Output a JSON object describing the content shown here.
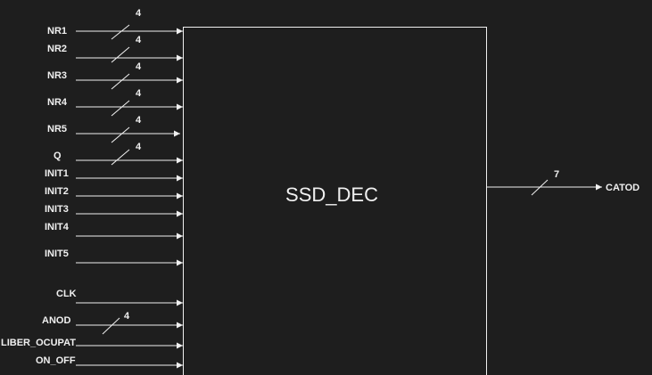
{
  "block": {
    "name": "SSD_DEC"
  },
  "inputs": [
    {
      "label": "NR1",
      "width": "4"
    },
    {
      "label": "NR2",
      "width": "4"
    },
    {
      "label": "NR3",
      "width": "4"
    },
    {
      "label": "NR4",
      "width": "4"
    },
    {
      "label": "NR5",
      "width": "4"
    },
    {
      "label": "Q",
      "width": "4"
    },
    {
      "label": "INIT1",
      "width": ""
    },
    {
      "label": "INIT2",
      "width": ""
    },
    {
      "label": "INIT3",
      "width": ""
    },
    {
      "label": "INIT4",
      "width": ""
    },
    {
      "label": "INIT5",
      "width": ""
    },
    {
      "label": "CLK",
      "width": ""
    },
    {
      "label": "ANOD",
      "width": "4"
    },
    {
      "label": "LIBER_OCUPAT",
      "width": ""
    },
    {
      "label": "ON_OFF",
      "width": ""
    }
  ],
  "output": {
    "label": "CATOD",
    "width": "7"
  },
  "colors": {
    "background": "#1e1e1e",
    "foreground": "#f0f0f0"
  }
}
